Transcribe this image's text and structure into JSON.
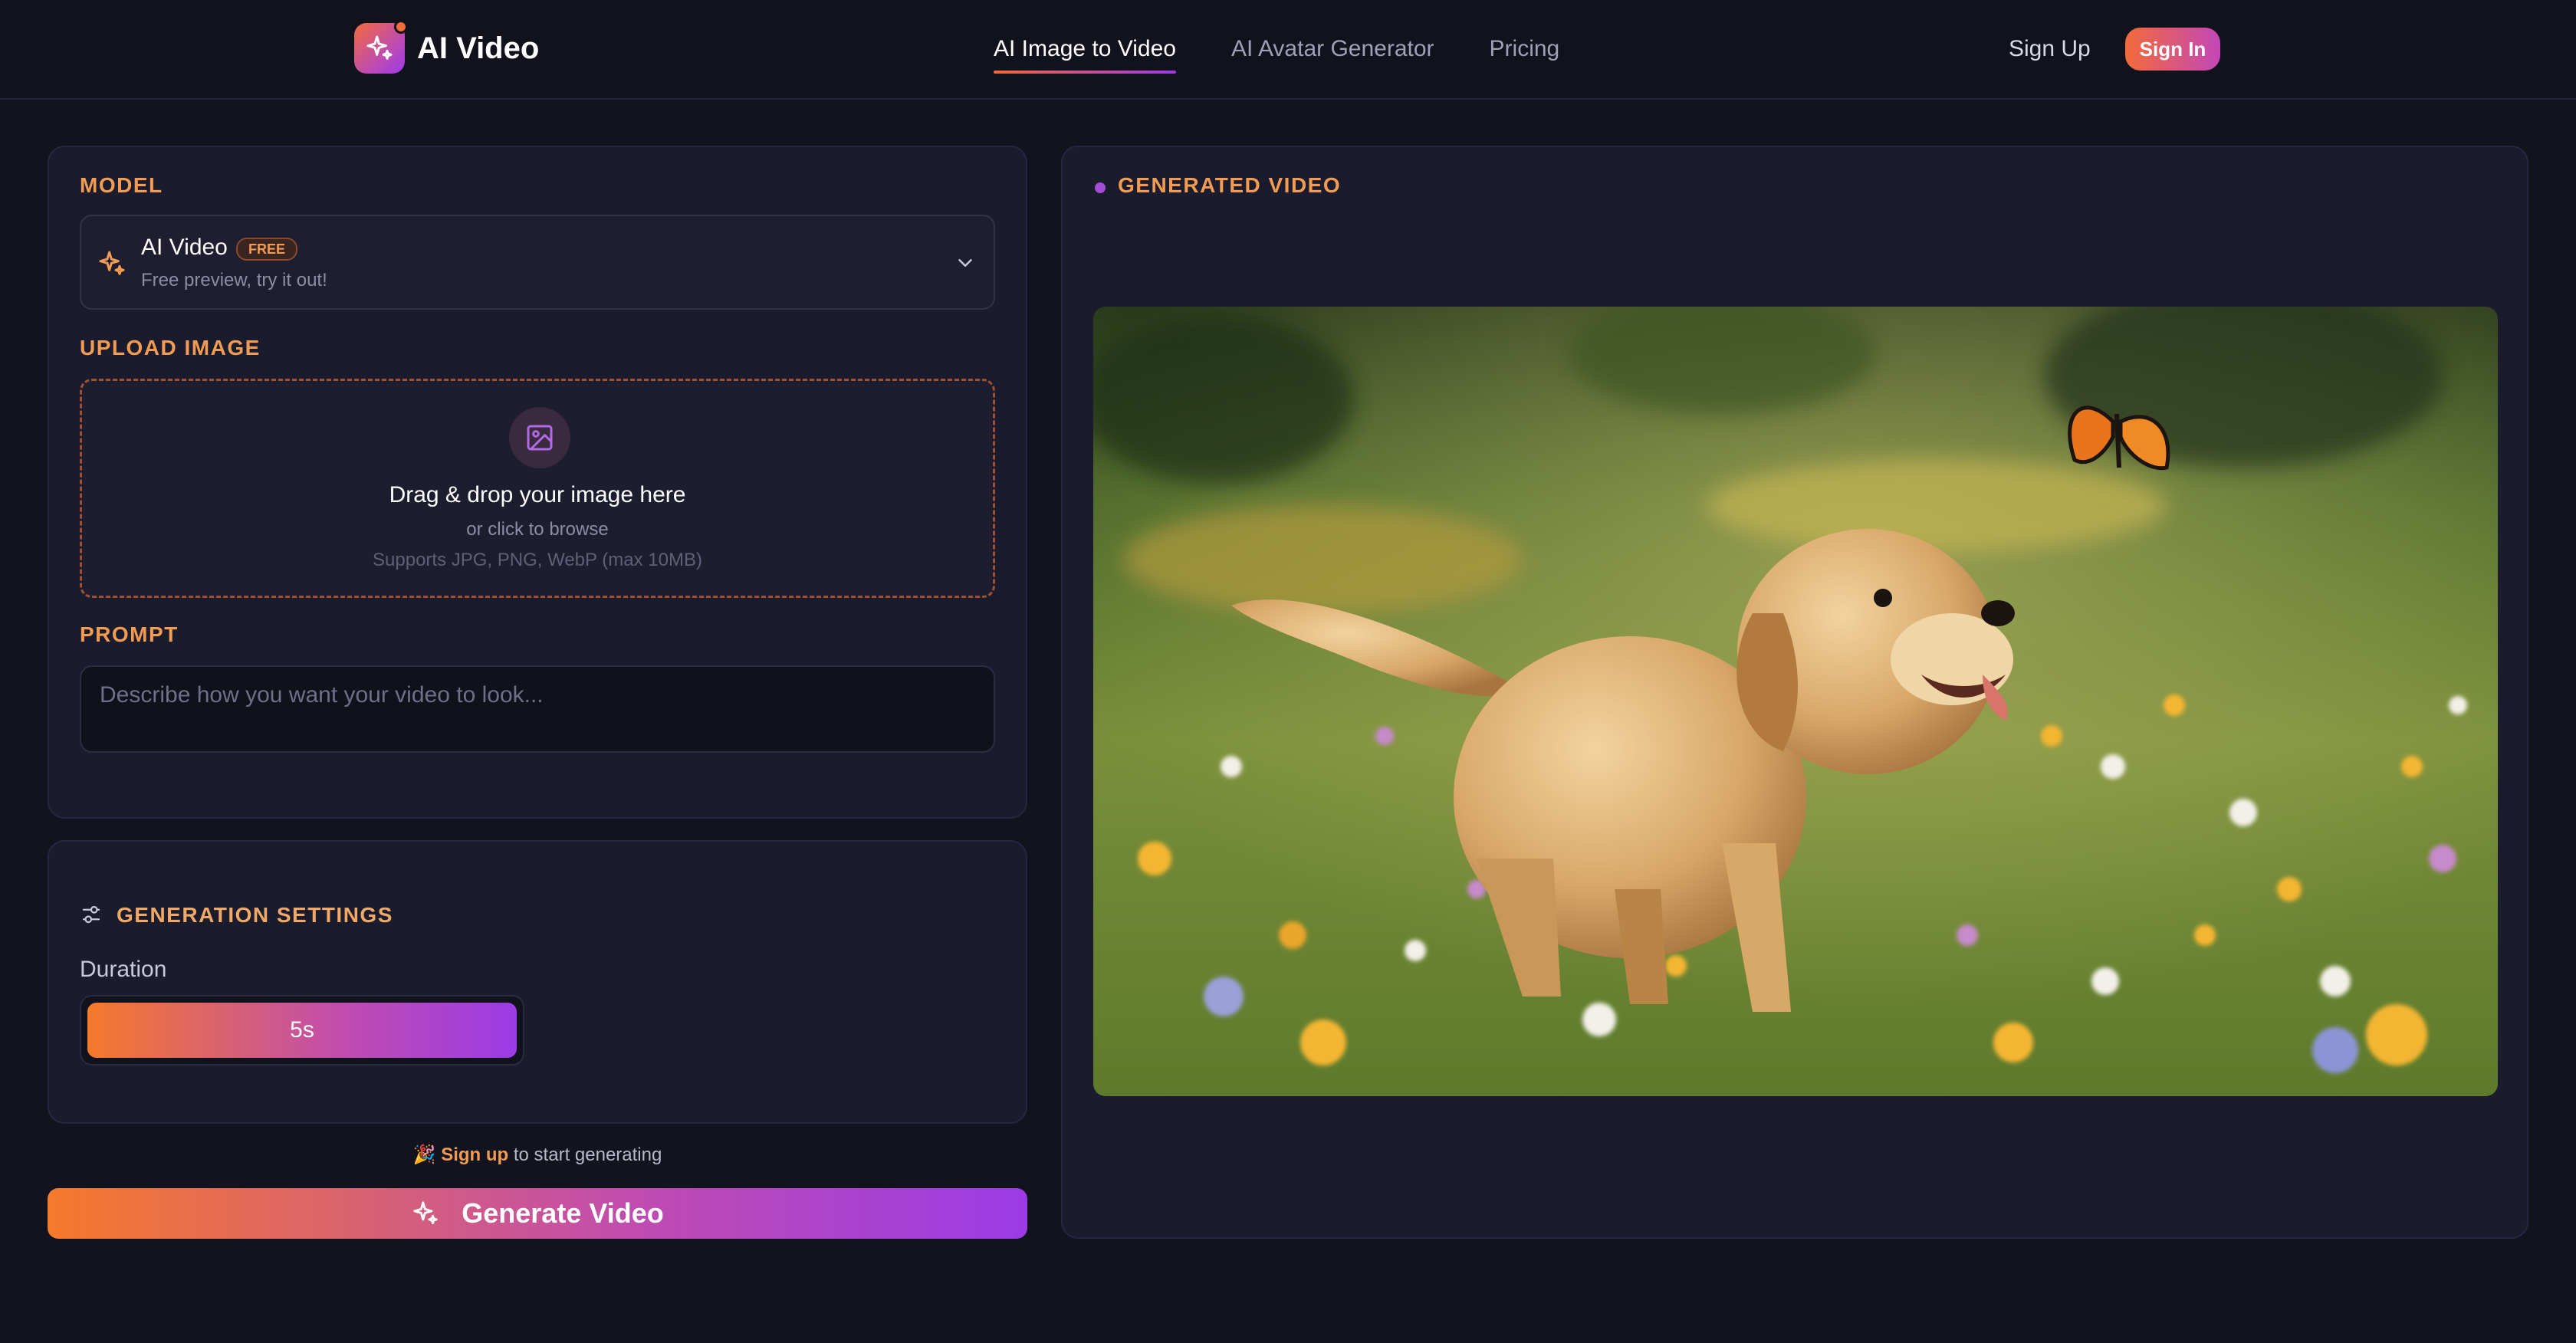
{
  "header": {
    "logo_text": "AI Video",
    "nav": [
      {
        "label": "AI Image to Video",
        "active": true
      },
      {
        "label": "AI Avatar Generator",
        "active": false
      },
      {
        "label": "Pricing",
        "active": false
      }
    ],
    "sign_up": "Sign Up",
    "sign_in": "Sign In"
  },
  "model": {
    "section_label": "MODEL",
    "name": "AI Video",
    "badge": "FREE",
    "description": "Free preview, try it out!"
  },
  "upload": {
    "section_label": "UPLOAD IMAGE",
    "title": "Drag & drop your image here",
    "subtitle": "or click to browse",
    "hint": "Supports JPG, PNG, WebP (max 10MB)"
  },
  "prompt": {
    "section_label": "PROMPT",
    "placeholder": "Describe how you want your video to look...",
    "value": ""
  },
  "settings": {
    "section_label": "GENERATION SETTINGS",
    "duration_label": "Duration",
    "duration_value": "5s"
  },
  "signup_hint": {
    "emoji": "🎉",
    "link": "Sign up",
    "rest": " to start generating"
  },
  "generate_label": "Generate Video",
  "video": {
    "section_label": "GENERATED VIDEO"
  },
  "colors": {
    "accent_orange": "#f29b52",
    "accent_purple": "#9b3be6",
    "background": "#13131f",
    "panel": "#1b1b2e"
  },
  "icons": [
    "sparkle-icon",
    "chevron-down-icon",
    "image-icon",
    "sliders-icon"
  ]
}
